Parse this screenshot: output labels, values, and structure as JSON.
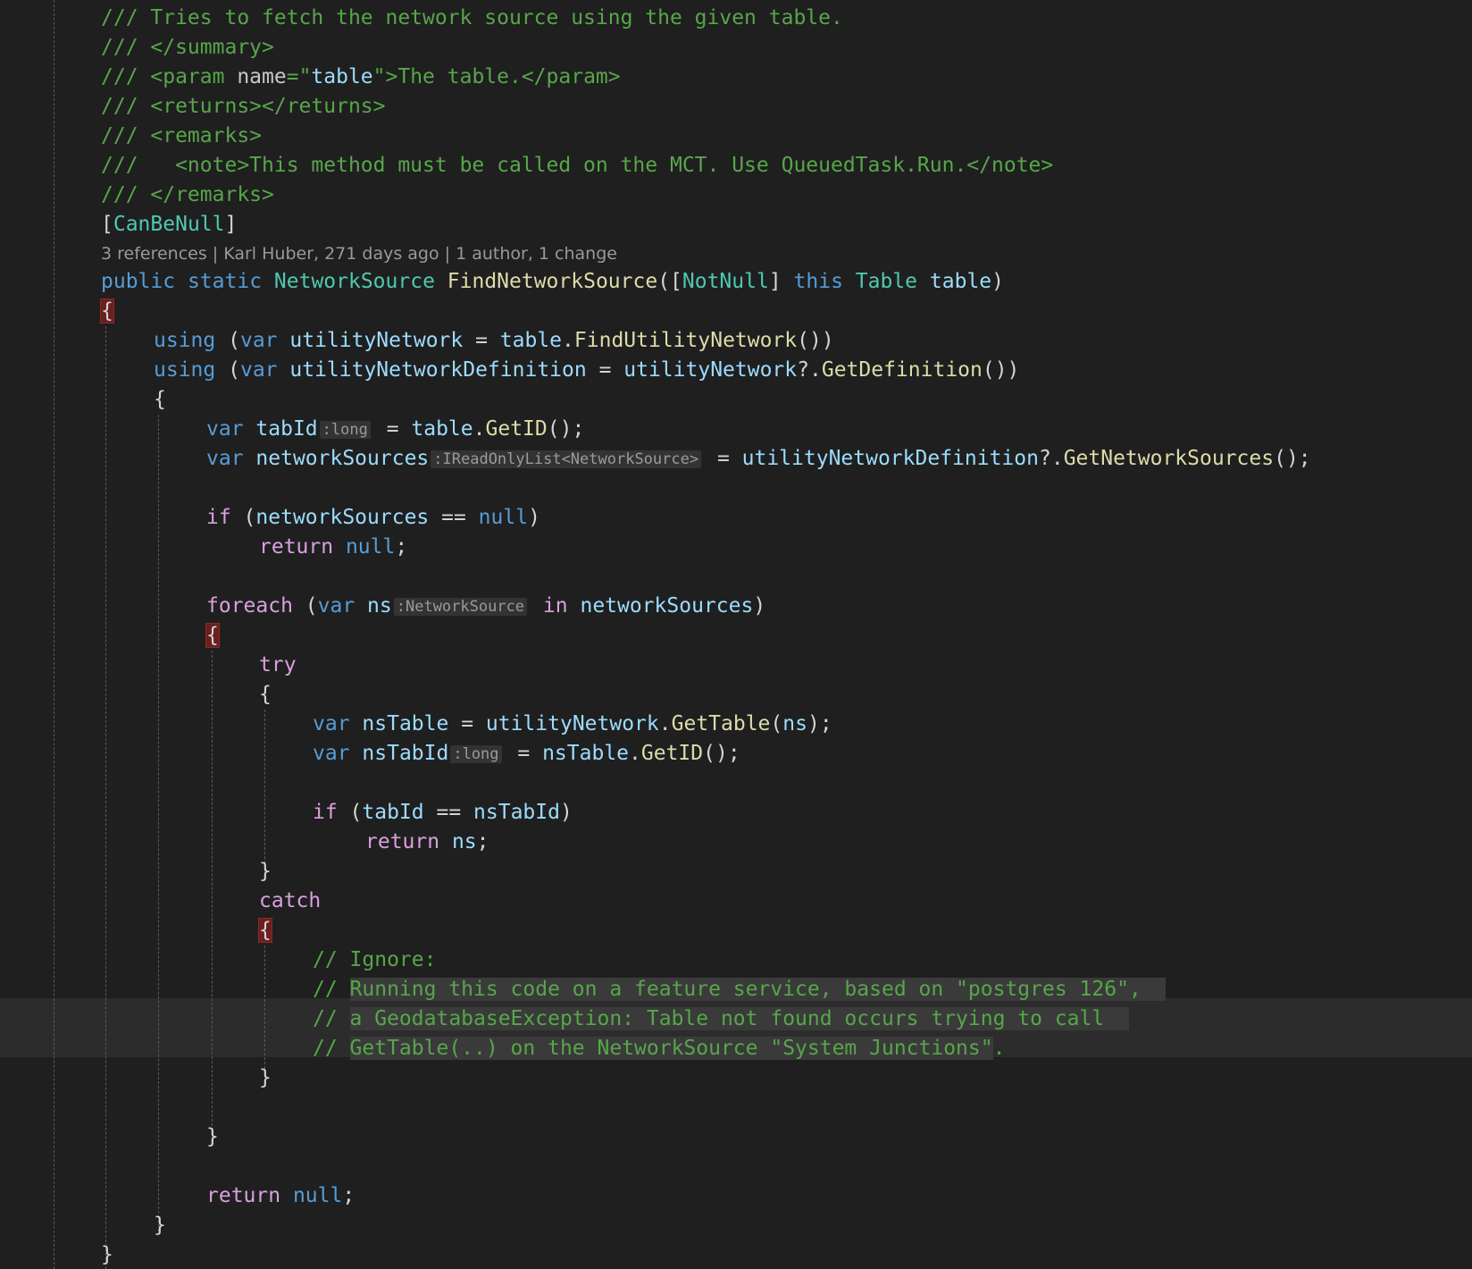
{
  "editor": {
    "codelens": "3 references | Karl Huber, 271 days ago | 1 author, 1 change",
    "colors": {
      "background": "#1f1f1f",
      "comment": "#57a64a",
      "keyword": "#569cd6",
      "control": "#d8a0df",
      "type": "#4ec9b0",
      "method": "#dcdcaa",
      "identifier": "#9cdcfe"
    },
    "code": {
      "l1": "/// Tries to fetch the network source using the given table.",
      "l2": "/// </summary>",
      "l3a": "/// <param ",
      "l3b": "name",
      "l3c": "=\"",
      "l3d": "table",
      "l3e": "\">The table.</param>",
      "l4": "/// <returns></returns>",
      "l5": "/// <remarks>",
      "l6": "///   <note>This method must be called on the MCT. Use QueuedTask.Run.</note>",
      "l7": "/// </remarks>",
      "l8a": "[",
      "l8b": "CanBeNull",
      "l8c": "]",
      "l10a": "public",
      "l10b": "static",
      "l10c": "NetworkSource",
      "l10d": "FindNetworkSource",
      "l10e": "([",
      "l10f": "NotNull",
      "l10g": "]",
      "l10h": "this",
      "l10i": "Table",
      "l10j": "table",
      "l10k": ")",
      "open_brace": "{",
      "close_brace": "}",
      "using": "using",
      "var": "var",
      "l12b": "utilityNetwork",
      "l12c": " = ",
      "l12d": "table",
      "l12e": ".",
      "l12f": "FindUtilityNetwork",
      "l12g": "())",
      "l13b": "utilityNetworkDefinition",
      "l13c": " = ",
      "l13d": "utilityNetwork",
      "l13e": "?.",
      "l13f": "GetDefinition",
      "l13g": "())",
      "l15b": "tabId",
      "hint_long": ":long",
      "l15c": " = ",
      "l15d": "table",
      "l15e": ".",
      "l15f": "GetID",
      "l15g": "();",
      "l16b": "networkSources",
      "hint_list": ":IReadOnlyList<NetworkSource>",
      "l16c": " = ",
      "l16d": "utilityNetworkDefinition",
      "l16e": "?.",
      "l16f": "GetNetworkSources",
      "l16g": "();",
      "if": "if",
      "l18b": " (",
      "l18c": "networkSources",
      "l18d": " == ",
      "null": "null",
      "l18e": ")",
      "return": "return",
      "semi": ";",
      "foreach": "foreach",
      "l21b": " (",
      "l21c": "ns",
      "hint_ns": ":NetworkSource",
      "in": "in",
      "l21d": "networkSources",
      "l21e": ")",
      "try": "try",
      "l25b": "nsTable",
      "l25c": " = ",
      "l25d": "utilityNetwork",
      "l25e": ".",
      "l25f": "GetTable",
      "l25g": "(",
      "l25h": "ns",
      "l25i": ");",
      "l26b": "nsTabId",
      "l26c": " = ",
      "l26d": "nsTable",
      "l26e": ".",
      "l26f": "GetID",
      "l26g": "();",
      "l28b": " (",
      "l28c": "tabId",
      "l28d": " == ",
      "l28e": "nsTabId",
      "l28f": ")",
      "l29b": "ns",
      "catch": "catch",
      "l33": "// Ignore:",
      "cmt_prefix": "// ",
      "l34": "Running this code on a feature service, based on \"postgres 126\",",
      "l35": "a GeodatabaseException: Table not found occurs trying to call",
      "l36a": "GetTable(..) on the NetworkSource \"System Junctions\"",
      "l36b": "."
    }
  }
}
